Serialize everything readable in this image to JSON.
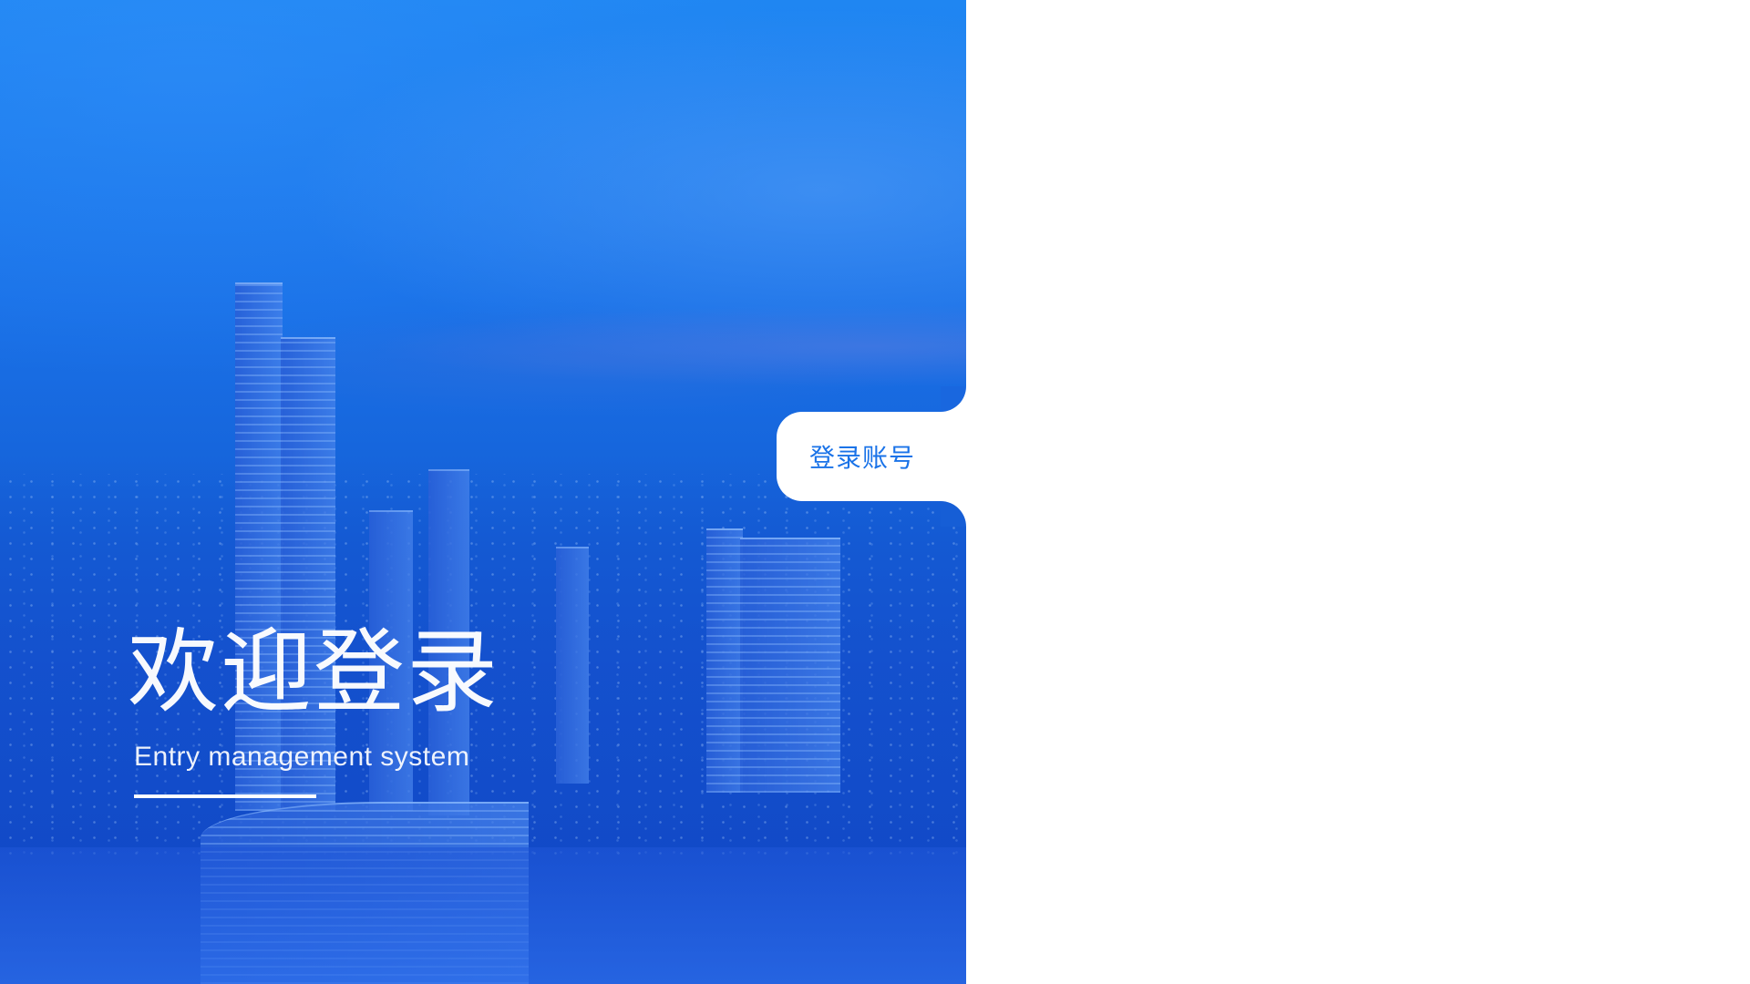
{
  "hero": {
    "title": "欢迎登录",
    "subtitle": "Entry management system"
  },
  "tab": {
    "label": "登录账号",
    "active": true
  },
  "colors": {
    "primary": "#1a73e8",
    "hero_top": "#1f86f2",
    "hero_bottom": "#1158cf",
    "background": "#ffffff"
  }
}
